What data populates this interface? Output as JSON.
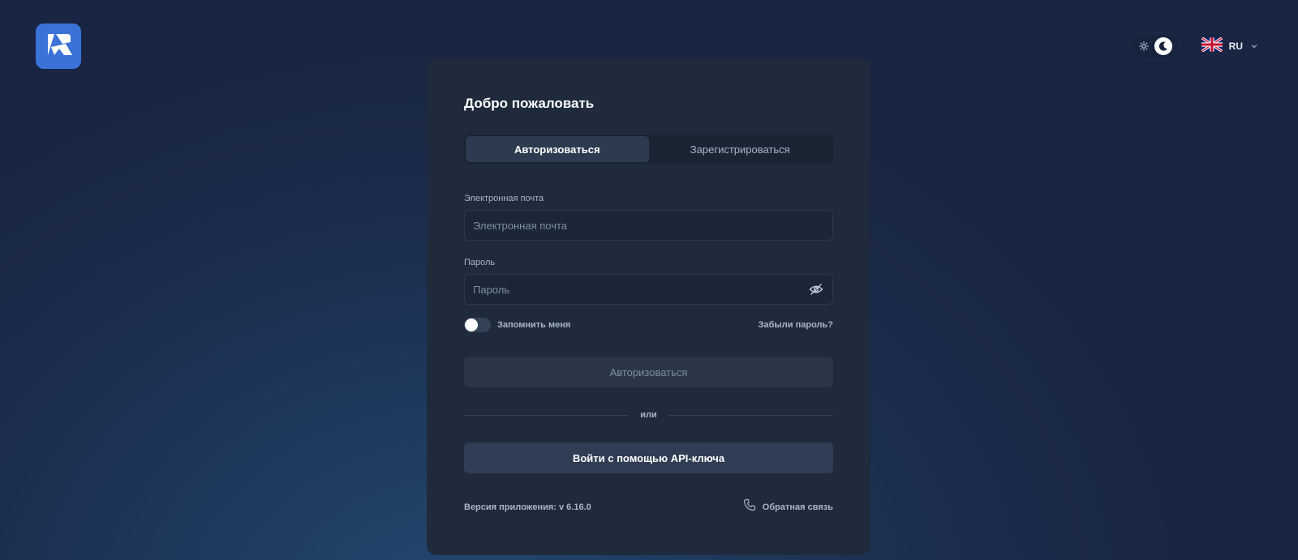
{
  "app": {
    "logo_icon": "app-logo-icon"
  },
  "header": {
    "theme_toggle": {
      "light_icon": "sun-icon",
      "dark_icon": "moon-icon",
      "active": "dark"
    },
    "language": {
      "flag_icon": "uk-flag-icon",
      "code": "RU",
      "chevron_icon": "chevron-down-icon"
    }
  },
  "login": {
    "title": "Добро пожаловать",
    "tabs": [
      {
        "label": "Авторизоваться",
        "active": true
      },
      {
        "label": "Зарегистрироваться",
        "active": false
      }
    ],
    "email": {
      "label": "Электронная почта",
      "placeholder": "Электронная почта",
      "value": ""
    },
    "password": {
      "label": "Пароль",
      "placeholder": "Пароль",
      "value": "",
      "visibility_icon": "eye-off-icon"
    },
    "remember_me": {
      "label": "Запомнить меня",
      "checked": false
    },
    "forgot_password": "Забыли пароль?",
    "submit_label": "Авторизоваться",
    "divider_text": "или",
    "api_key_button": "Войти с помощью API-ключа",
    "version": "Версия приложения: v 6.16.0",
    "feedback": {
      "label": "Обратная связь",
      "icon": "phone-icon"
    }
  },
  "colors": {
    "accent": "#3a72d8",
    "card_bg": "#1f2b3c",
    "page_bg": "#1c2e4f"
  }
}
